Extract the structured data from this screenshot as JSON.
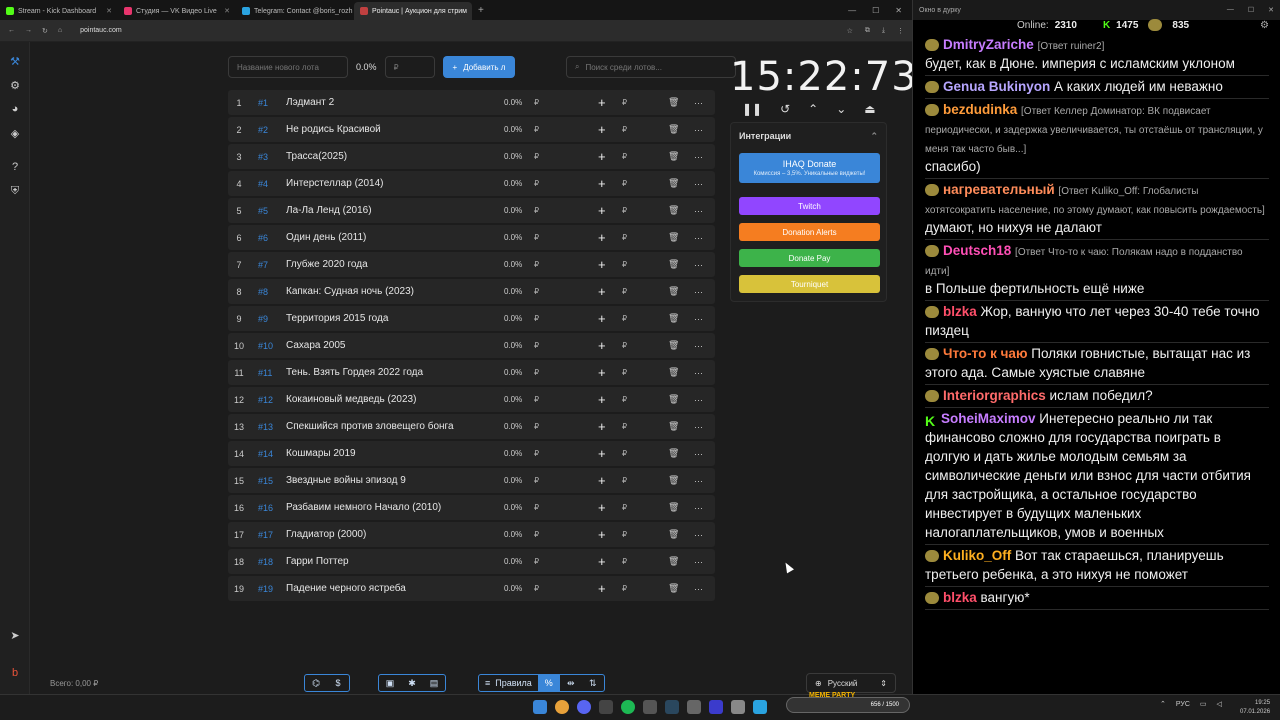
{
  "browser": {
    "tabs": [
      {
        "label": "Stream - Kick Dashboard",
        "color": "#53fc18"
      },
      {
        "label": "Студия — VK Видео Live",
        "color": "#e8356d"
      },
      {
        "label": "Telegram: Contact @boris_rozh",
        "color": "#2aa3e0"
      },
      {
        "label": "Pointauc | Аукцион для стрим",
        "color": "#c04040"
      }
    ],
    "url": "pointauc.com"
  },
  "toolbar": {
    "lot_name_placeholder": "Название нового лота",
    "percent": "0.0%",
    "amount_placeholder": "₽",
    "add_label": "Добавить л",
    "search_placeholder": "Поиск среди лотов..."
  },
  "lots": [
    {
      "n": "1",
      "id": "#1",
      "name": "Лэдмант 2",
      "pct": "0.0%"
    },
    {
      "n": "2",
      "id": "#2",
      "name": "Не родись Красивой",
      "pct": "0.0%"
    },
    {
      "n": "3",
      "id": "#3",
      "name": "Трасса(2025)",
      "pct": "0.0%"
    },
    {
      "n": "4",
      "id": "#4",
      "name": "Интерстеллар (2014)",
      "pct": "0.0%"
    },
    {
      "n": "5",
      "id": "#5",
      "name": "Ла-Ла Ленд (2016)",
      "pct": "0.0%"
    },
    {
      "n": "6",
      "id": "#6",
      "name": "Один день (2011)",
      "pct": "0.0%"
    },
    {
      "n": "7",
      "id": "#7",
      "name": "Глубже 2020 года",
      "pct": "0.0%"
    },
    {
      "n": "8",
      "id": "#8",
      "name": "Капкан: Судная ночь (2023)",
      "pct": "0.0%"
    },
    {
      "n": "9",
      "id": "#9",
      "name": "Территория 2015 года",
      "pct": "0.0%"
    },
    {
      "n": "10",
      "id": "#10",
      "name": "Сахара 2005",
      "pct": "0.0%"
    },
    {
      "n": "11",
      "id": "#11",
      "name": "Тень. Взять Гордея 2022 года",
      "pct": "0.0%"
    },
    {
      "n": "12",
      "id": "#12",
      "name": "Кокаиновый медведь (2023)",
      "pct": "0.0%"
    },
    {
      "n": "13",
      "id": "#13",
      "name": "Спекшийся против зловещего бонга",
      "pct": "0.0%"
    },
    {
      "n": "14",
      "id": "#14",
      "name": "Кошмары 2019",
      "pct": "0.0%"
    },
    {
      "n": "15",
      "id": "#15",
      "name": "Звездные войны эпизод 9",
      "pct": "0.0%"
    },
    {
      "n": "16",
      "id": "#16",
      "name": "Разбавим немного Начало (2010)",
      "pct": "0.0%"
    },
    {
      "n": "17",
      "id": "#17",
      "name": "Гладиатор (2000)",
      "pct": "0.0%"
    },
    {
      "n": "18",
      "id": "#18",
      "name": "Гарри Поттер",
      "pct": "0.0%"
    },
    {
      "n": "19",
      "id": "#19",
      "name": "Падение черного ястреба",
      "pct": "0.0%"
    }
  ],
  "currency": "₽",
  "timer": "15:22:73",
  "integrations": {
    "title": "Интеграции",
    "ihaq": "IHAQ Donate",
    "ihaq_sub": "Комиссия – 3,5%. Уникальные виджеты!",
    "twitch": "Twitch",
    "donation_alerts": "Donation Alerts",
    "donate_pay": "Donate Pay",
    "tourniquet": "Tourniquet",
    "colors": {
      "ihaq": "#3a86d8",
      "twitch": "#9146ff",
      "da": "#f57d20",
      "dp": "#3db34a",
      "tq": "#d8c23a"
    }
  },
  "footer": {
    "total": "Всего: 0,00 ₽",
    "rules": "Правила",
    "percent_btn": "%",
    "language": "Русский"
  },
  "chat": {
    "window_title": "Окно в дурку",
    "online_label": "Online:",
    "online": "2310",
    "kick_count": "1475",
    "other_count": "835",
    "messages": [
      {
        "user": "DmitryZariche",
        "color": "#c77dff",
        "reply": "[Ответ ruiner2]",
        "text": "будет, как в Дюне. империя с исламским уклоном"
      },
      {
        "user": "Genua Bukinyon",
        "color": "#b7a6ff",
        "reply": "",
        "text": "А каких людей им неважно"
      },
      {
        "user": "bezdudinka",
        "color": "#ff9c3b",
        "reply": "[Ответ Келлер Доминатор: ВК подвисает периодически, и задержка увеличивается, ты отстаёшь от трансляции, у меня так часто быв...]",
        "text": "спасибо)"
      },
      {
        "user": "нагревательный",
        "color": "#ff8c5a",
        "reply": "[Ответ Kuliko_Off: Глобалисты хотятсократить население, по этому думают, как повысить рождаемость]",
        "text": "думают, но нихуя не далают"
      },
      {
        "user": "Deutsch18",
        "color": "#ff4fb6",
        "reply": "[Ответ Что-то к чаю: Полякам надо в подданство идти]",
        "text": "в Польше фертильность ещё ниже"
      },
      {
        "user": "blzka",
        "color": "#ff4f6a",
        "reply": "",
        "text": "Жор, ванную что лет через 30-40 тебе точно пиздец"
      },
      {
        "user": "Что-то к чаю",
        "color": "#ff7a3b",
        "reply": "",
        "text": "Поляки говнистые, вытащат нас из этого ада. Самые хуястые славяне"
      },
      {
        "user": "Interiorgraphics",
        "color": "#ff6b6b",
        "reply": "",
        "text": "ислам победил?"
      },
      {
        "user": "SoheiMaximov",
        "color": "#c77dff",
        "reply": "",
        "text": "Инетересно реально ли так финансово сложно для государства поиграть в долгую и дать жилье молодым семьям за символические деньги или взнос для части отбития для застройщика, а остальное государство инвестирует в будущих маленьких налогаплательщиков, умов и военных"
      },
      {
        "user": "Kuliko_Off",
        "color": "#ffb020",
        "reply": "",
        "text": "Вот так стараешься, планируешь третьего ребенка, а это нихуя не поможет"
      },
      {
        "user": "blzka",
        "color": "#ff4f6a",
        "reply": "",
        "text": "вангую*"
      }
    ]
  },
  "taskbar": {
    "stream_label": "MEME PARTY",
    "stream_progress": "656 / 1500",
    "lang": "РУС",
    "time": "19:25",
    "date": "07.01.2026"
  }
}
